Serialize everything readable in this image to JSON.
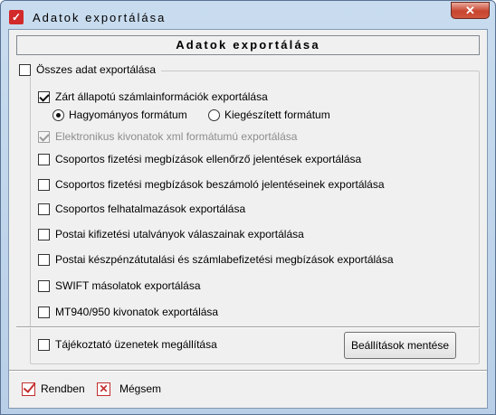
{
  "window": {
    "title": "Adatok exportálása",
    "app_icon": "form-icon",
    "close_glyph": "✕"
  },
  "header": {
    "title": "Adatok exportálása"
  },
  "group": {
    "all_label": "Összes adat exportálása",
    "all_checked": false
  },
  "options": {
    "closed_state": {
      "label": "Zárt állapotú számlainformációk exportálása",
      "checked": true
    },
    "format_standard": {
      "label": "Hagyományos formátum",
      "selected": true
    },
    "format_extended": {
      "label": "Kiegészített formátum",
      "selected": false
    },
    "electronic_xml": {
      "label": "Elektronikus kivonatok xml formátumú exportálása",
      "checked": true,
      "disabled": true
    },
    "group_control": {
      "label": "Csoportos fizetési megbízások ellenőrző jelentések exportálása",
      "checked": false
    },
    "group_report": {
      "label": "Csoportos fizetési megbízások beszámoló jelentéseinek exportálása",
      "checked": false
    },
    "group_authorization": {
      "label": "Csoportos felhatalmazások exportálása",
      "checked": false
    },
    "postal_payout": {
      "label": "Postai kifizetési utalványok válaszainak exportálása",
      "checked": false
    },
    "postal_cash": {
      "label": "Postai készpénzátutalási és számlabefizetési megbízások exportálása",
      "checked": false
    },
    "swift": {
      "label": "SWIFT másolatok exportálása",
      "checked": false
    },
    "mt940": {
      "label": "MT940/950 kivonatok exportálása",
      "checked": false
    }
  },
  "info_messages": {
    "label": "Tájékoztató üzenetek megállítása",
    "checked": false
  },
  "save_settings_label": "Beállítások mentése",
  "footer": {
    "ok_label": "Rendben",
    "cancel_label": "Mégsem",
    "ok_icon": "check-icon",
    "cancel_icon": "cross-icon"
  },
  "colors": {
    "accent_red": "#c32e2e",
    "window_frame": "#b8cfe7",
    "client_bg": "#f0f0f0"
  }
}
